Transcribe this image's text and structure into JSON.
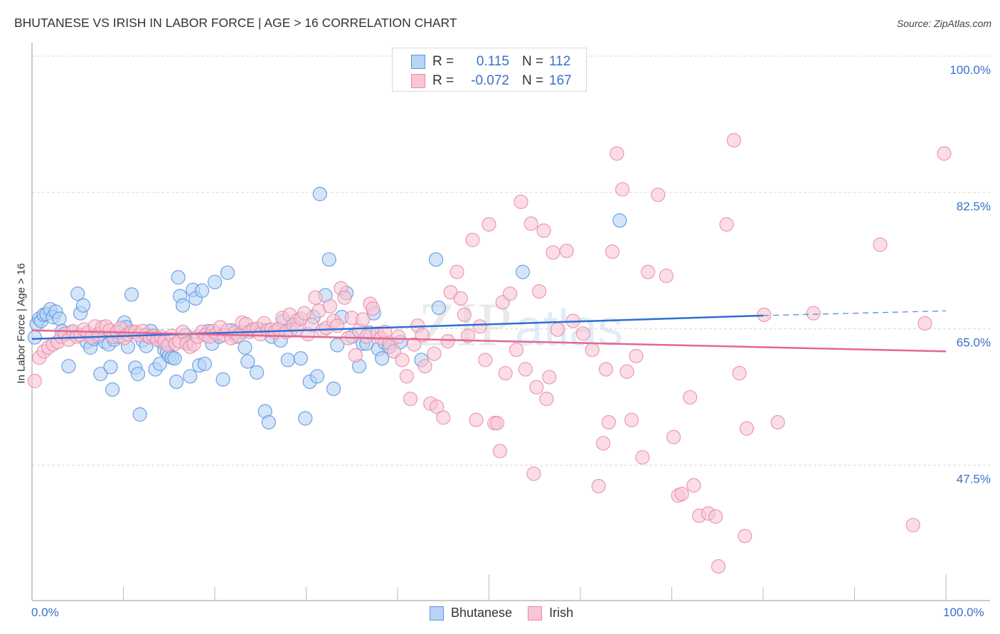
{
  "header": {
    "title": "BHUTANESE VS IRISH IN LABOR FORCE | AGE > 16 CORRELATION CHART",
    "source": "Source: ZipAtlas.com"
  },
  "legend_top": {
    "rows": [
      {
        "r_label": "R =",
        "r_value": "0.115",
        "n_label": "N =",
        "n_value": "112"
      },
      {
        "r_label": "R =",
        "r_value": "-0.072",
        "n_label": "N =",
        "n_value": "167"
      }
    ]
  },
  "colors": {
    "bhutanese_fill": "#b8d3f5",
    "bhutanese_stroke": "#5b93df",
    "bhutanese_line": "#2d6fd3",
    "irish_fill": "#f9c6d5",
    "irish_stroke": "#e88aa6",
    "irish_line": "#e4678f",
    "axis_text": "#3a6fcc",
    "grid": "#d9d9d9"
  },
  "chart_data": {
    "type": "scatter",
    "title": "BHUTANESE VS IRISH IN LABOR FORCE | AGE > 16 CORRELATION CHART",
    "xlabel": "",
    "ylabel": "In Labor Force | Age > 16",
    "xlim": [
      0,
      100
    ],
    "ylim": [
      30,
      100
    ],
    "x_tick_labels": [
      "0.0%",
      "100.0%"
    ],
    "y_ticks": [
      47.5,
      65.0,
      82.5,
      100.0
    ],
    "y_tick_labels": [
      "47.5%",
      "65.0%",
      "82.5%",
      "100.0%"
    ],
    "grid": true,
    "legend": {
      "placement": "bottom",
      "entries": [
        "Bhutanese",
        "Irish"
      ]
    },
    "watermark": "ZIPatlas",
    "series": [
      {
        "name": "Bhutanese",
        "r": 0.115,
        "n": 112,
        "trend": {
          "x0": 0,
          "y0": 63.7,
          "x1": 80,
          "y1": 66.7,
          "dashed_to_x": 100,
          "dashed_to_y": 67.3
        },
        "points": [
          [
            0.3,
            63.9
          ],
          [
            0.5,
            65.6
          ],
          [
            0.8,
            66.3
          ],
          [
            1.0,
            66.0
          ],
          [
            1.3,
            66.8
          ],
          [
            1.6,
            66.9
          ],
          [
            2.0,
            67.5
          ],
          [
            2.3,
            66.5
          ],
          [
            2.6,
            67.2
          ],
          [
            3.0,
            66.3
          ],
          [
            3.3,
            64.7
          ],
          [
            3.6,
            64.3
          ],
          [
            4.0,
            60.2
          ],
          [
            4.4,
            64.5
          ],
          [
            5.0,
            69.5
          ],
          [
            5.3,
            67.0
          ],
          [
            5.6,
            68.0
          ],
          [
            6.0,
            63.3
          ],
          [
            6.4,
            62.6
          ],
          [
            6.8,
            63.7
          ],
          [
            7.2,
            64.0
          ],
          [
            7.5,
            59.2
          ],
          [
            8.0,
            63.3
          ],
          [
            8.4,
            63.0
          ],
          [
            8.6,
            60.1
          ],
          [
            8.8,
            57.2
          ],
          [
            9.0,
            63.6
          ],
          [
            9.5,
            64.0
          ],
          [
            9.8,
            64.7
          ],
          [
            10.1,
            65.8
          ],
          [
            10.3,
            65.2
          ],
          [
            10.5,
            62.7
          ],
          [
            10.9,
            69.4
          ],
          [
            11.3,
            60.0
          ],
          [
            11.6,
            59.2
          ],
          [
            11.8,
            54.0
          ],
          [
            12.1,
            63.5
          ],
          [
            12.5,
            62.8
          ],
          [
            12.8,
            64.0
          ],
          [
            13.0,
            64.7
          ],
          [
            13.3,
            64.1
          ],
          [
            13.5,
            59.8
          ],
          [
            13.8,
            63.8
          ],
          [
            14.0,
            60.5
          ],
          [
            14.2,
            63.3
          ],
          [
            14.5,
            62.3
          ],
          [
            14.8,
            62.0
          ],
          [
            15.0,
            61.5
          ],
          [
            15.3,
            61.3
          ],
          [
            15.6,
            61.2
          ],
          [
            15.8,
            58.2
          ],
          [
            16.0,
            71.6
          ],
          [
            16.2,
            69.2
          ],
          [
            16.5,
            68.0
          ],
          [
            16.8,
            64.2
          ],
          [
            17.0,
            63.3
          ],
          [
            17.3,
            58.9
          ],
          [
            17.6,
            70.0
          ],
          [
            17.9,
            68.9
          ],
          [
            18.3,
            60.3
          ],
          [
            18.6,
            69.9
          ],
          [
            18.9,
            60.5
          ],
          [
            19.3,
            64.7
          ],
          [
            19.7,
            63.1
          ],
          [
            20.0,
            71.0
          ],
          [
            20.5,
            64.0
          ],
          [
            20.9,
            58.5
          ],
          [
            21.4,
            72.2
          ],
          [
            21.8,
            64.8
          ],
          [
            22.3,
            64.0
          ],
          [
            23.0,
            64.6
          ],
          [
            23.3,
            62.6
          ],
          [
            23.6,
            60.8
          ],
          [
            24.0,
            64.8
          ],
          [
            24.6,
            59.4
          ],
          [
            25.0,
            64.9
          ],
          [
            25.5,
            54.4
          ],
          [
            25.9,
            53.0
          ],
          [
            26.2,
            64.0
          ],
          [
            27.2,
            63.5
          ],
          [
            27.5,
            66.0
          ],
          [
            28.0,
            61.0
          ],
          [
            28.3,
            64.8
          ],
          [
            29.0,
            66.1
          ],
          [
            29.4,
            61.2
          ],
          [
            29.9,
            53.5
          ],
          [
            30.4,
            58.2
          ],
          [
            30.8,
            66.5
          ],
          [
            31.2,
            58.9
          ],
          [
            31.5,
            82.3
          ],
          [
            32.1,
            69.3
          ],
          [
            32.5,
            73.9
          ],
          [
            33.0,
            57.3
          ],
          [
            33.4,
            62.9
          ],
          [
            33.9,
            66.5
          ],
          [
            34.4,
            69.6
          ],
          [
            35.0,
            64.0
          ],
          [
            35.8,
            60.2
          ],
          [
            36.2,
            63.1
          ],
          [
            36.6,
            63.1
          ],
          [
            36.9,
            64.5
          ],
          [
            37.4,
            67.0
          ],
          [
            37.9,
            62.4
          ],
          [
            38.3,
            61.2
          ],
          [
            38.6,
            63.2
          ],
          [
            39.1,
            62.7
          ],
          [
            40.3,
            63.3
          ],
          [
            42.6,
            61.0
          ],
          [
            44.2,
            73.9
          ],
          [
            44.5,
            67.7
          ],
          [
            53.7,
            72.3
          ],
          [
            64.3,
            78.9
          ]
        ]
      },
      {
        "name": "Irish",
        "r": -0.072,
        "n": 167,
        "trend": {
          "x0": 0,
          "y0": 64.8,
          "x1": 100,
          "y1": 62.1
        },
        "points": [
          [
            0.3,
            58.3
          ],
          [
            0.8,
            61.3
          ],
          [
            1.3,
            62.1
          ],
          [
            1.8,
            62.6
          ],
          [
            2.3,
            63.0
          ],
          [
            2.8,
            63.3
          ],
          [
            3.2,
            64.0
          ],
          [
            3.6,
            64.4
          ],
          [
            4.0,
            63.6
          ],
          [
            4.5,
            64.7
          ],
          [
            4.9,
            64.0
          ],
          [
            5.3,
            64.2
          ],
          [
            5.7,
            64.9
          ],
          [
            6.1,
            64.5
          ],
          [
            6.5,
            63.9
          ],
          [
            6.9,
            65.3
          ],
          [
            7.3,
            64.3
          ],
          [
            7.7,
            65.2
          ],
          [
            8.1,
            65.3
          ],
          [
            8.5,
            64.8
          ],
          [
            8.9,
            64.0
          ],
          [
            9.3,
            64.6
          ],
          [
            9.7,
            65.1
          ],
          [
            10.1,
            63.8
          ],
          [
            10.5,
            64.3
          ],
          [
            10.9,
            64.6
          ],
          [
            11.3,
            64.6
          ],
          [
            11.7,
            64.2
          ],
          [
            12.1,
            64.7
          ],
          [
            12.5,
            64.2
          ],
          [
            12.9,
            63.9
          ],
          [
            13.3,
            64.1
          ],
          [
            13.7,
            63.6
          ],
          [
            14.1,
            64.0
          ],
          [
            14.5,
            63.4
          ],
          [
            14.9,
            62.9
          ],
          [
            15.3,
            64.1
          ],
          [
            15.7,
            63.1
          ],
          [
            16.1,
            63.4
          ],
          [
            16.5,
            64.6
          ],
          [
            16.9,
            63.1
          ],
          [
            17.3,
            62.7
          ],
          [
            17.7,
            63.0
          ],
          [
            18.1,
            64.0
          ],
          [
            18.6,
            64.6
          ],
          [
            19.0,
            64.2
          ],
          [
            19.4,
            64.0
          ],
          [
            19.8,
            64.7
          ],
          [
            20.2,
            64.4
          ],
          [
            20.6,
            65.2
          ],
          [
            21.0,
            64.2
          ],
          [
            21.4,
            64.8
          ],
          [
            21.8,
            63.8
          ],
          [
            22.2,
            64.5
          ],
          [
            22.6,
            64.1
          ],
          [
            23.0,
            65.8
          ],
          [
            23.4,
            65.6
          ],
          [
            23.8,
            64.6
          ],
          [
            24.2,
            64.9
          ],
          [
            24.6,
            65.0
          ],
          [
            25.0,
            64.3
          ],
          [
            25.4,
            65.7
          ],
          [
            25.8,
            64.8
          ],
          [
            26.2,
            64.9
          ],
          [
            26.6,
            64.6
          ],
          [
            27.0,
            65.0
          ],
          [
            27.4,
            66.4
          ],
          [
            27.8,
            64.6
          ],
          [
            28.2,
            66.8
          ],
          [
            28.6,
            65.5
          ],
          [
            29.0,
            65.0
          ],
          [
            29.4,
            66.3
          ],
          [
            29.8,
            67.0
          ],
          [
            30.2,
            64.3
          ],
          [
            30.6,
            65.5
          ],
          [
            31.0,
            69.0
          ],
          [
            31.4,
            67.3
          ],
          [
            31.8,
            64.8
          ],
          [
            32.2,
            65.1
          ],
          [
            32.6,
            67.9
          ],
          [
            33.0,
            66.0
          ],
          [
            33.4,
            65.4
          ],
          [
            33.8,
            70.2
          ],
          [
            34.2,
            69.0
          ],
          [
            34.6,
            63.8
          ],
          [
            35.0,
            66.4
          ],
          [
            35.4,
            61.6
          ],
          [
            35.8,
            64.8
          ],
          [
            36.2,
            66.2
          ],
          [
            36.6,
            64.0
          ],
          [
            37.0,
            68.2
          ],
          [
            37.3,
            67.6
          ],
          [
            37.8,
            64.4
          ],
          [
            38.2,
            63.8
          ],
          [
            38.6,
            64.6
          ],
          [
            39.1,
            63.2
          ],
          [
            39.6,
            62.1
          ],
          [
            40.1,
            64.0
          ],
          [
            40.5,
            61.0
          ],
          [
            41.0,
            58.9
          ],
          [
            41.4,
            56.0
          ],
          [
            41.8,
            63.0
          ],
          [
            42.2,
            65.4
          ],
          [
            42.7,
            64.2
          ],
          [
            43.0,
            60.2
          ],
          [
            43.6,
            55.4
          ],
          [
            44.0,
            61.8
          ],
          [
            44.3,
            55.0
          ],
          [
            45.0,
            53.6
          ],
          [
            45.5,
            63.4
          ],
          [
            45.8,
            69.7
          ],
          [
            46.5,
            72.3
          ],
          [
            46.9,
            68.9
          ],
          [
            47.3,
            66.8
          ],
          [
            47.7,
            64.1
          ],
          [
            48.2,
            76.4
          ],
          [
            48.6,
            53.3
          ],
          [
            49.0,
            65.3
          ],
          [
            49.6,
            61.0
          ],
          [
            50.0,
            78.4
          ],
          [
            50.6,
            52.9
          ],
          [
            50.9,
            52.9
          ],
          [
            51.2,
            49.3
          ],
          [
            51.5,
            68.4
          ],
          [
            51.8,
            59.3
          ],
          [
            52.3,
            69.5
          ],
          [
            53.0,
            62.3
          ],
          [
            53.5,
            81.3
          ],
          [
            54.0,
            59.8
          ],
          [
            54.6,
            78.5
          ],
          [
            54.9,
            46.4
          ],
          [
            55.2,
            57.5
          ],
          [
            55.5,
            69.8
          ],
          [
            56.0,
            77.6
          ],
          [
            56.3,
            56.0
          ],
          [
            56.6,
            58.8
          ],
          [
            57.0,
            74.8
          ],
          [
            57.5,
            64.9
          ],
          [
            58.5,
            75.0
          ],
          [
            59.2,
            66.0
          ],
          [
            60.3,
            64.4
          ],
          [
            61.3,
            62.3
          ],
          [
            62.0,
            44.8
          ],
          [
            62.5,
            50.3
          ],
          [
            62.8,
            59.8
          ],
          [
            63.1,
            53.0
          ],
          [
            63.5,
            74.9
          ],
          [
            64.0,
            87.5
          ],
          [
            64.6,
            82.9
          ],
          [
            65.1,
            59.5
          ],
          [
            65.6,
            53.3
          ],
          [
            66.1,
            61.5
          ],
          [
            66.8,
            48.5
          ],
          [
            67.4,
            72.3
          ],
          [
            68.5,
            82.2
          ],
          [
            69.4,
            71.8
          ],
          [
            70.2,
            51.1
          ],
          [
            70.7,
            43.6
          ],
          [
            71.1,
            43.8
          ],
          [
            72.0,
            56.2
          ],
          [
            72.4,
            44.9
          ],
          [
            73.0,
            41.0
          ],
          [
            74.0,
            41.3
          ],
          [
            74.8,
            40.9
          ],
          [
            75.1,
            34.5
          ],
          [
            76.0,
            78.4
          ],
          [
            76.8,
            89.2
          ],
          [
            77.4,
            59.3
          ],
          [
            78.0,
            38.4
          ],
          [
            78.2,
            52.2
          ],
          [
            80.1,
            66.8
          ],
          [
            81.6,
            53.0
          ],
          [
            85.5,
            67.0
          ],
          [
            92.8,
            75.8
          ],
          [
            96.4,
            39.8
          ],
          [
            97.7,
            65.7
          ],
          [
            99.8,
            87.5
          ]
        ]
      }
    ]
  }
}
